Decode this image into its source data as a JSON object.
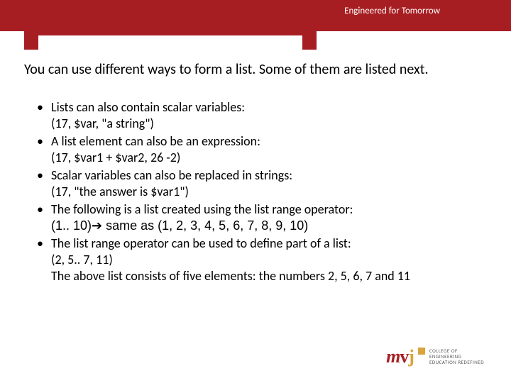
{
  "header": {
    "tagline": "Engineered for Tomorrow"
  },
  "intro": "You can use different ways to form a list. Some of them are listed next.",
  "bullets": [
    {
      "text": "Lists can also contain scalar variables:",
      "sub": "(17, $var, \"a string\")"
    },
    {
      "text": "A list element can also be an expression:",
      "sub": "(17, $var1 + $var2, 26 -2)"
    },
    {
      "text": "Scalar variables can also be replaced in strings:",
      "sub": "(17, \"the answer is $var1\")"
    },
    {
      "text": "The following is a list created using the list range operator:",
      "sub": "(1.. 10)➔ same as (1, 2, 3, 4, 5, 6, 7, 8, 9, 10)"
    },
    {
      "text": "The list range operator can be used to define part of a list:",
      "sub": "(2, 5.. 7, 11)",
      "sub2": "The above list consists of five elements: the numbers 2, 5, 6, 7 and 11"
    }
  ],
  "logo": {
    "mark_m": "m",
    "mark_v": "v",
    "mark_j": "j",
    "line1": "COLLEGE OF",
    "line2": "ENGINEERING",
    "line3": "EDUCATION REDEFINED"
  }
}
